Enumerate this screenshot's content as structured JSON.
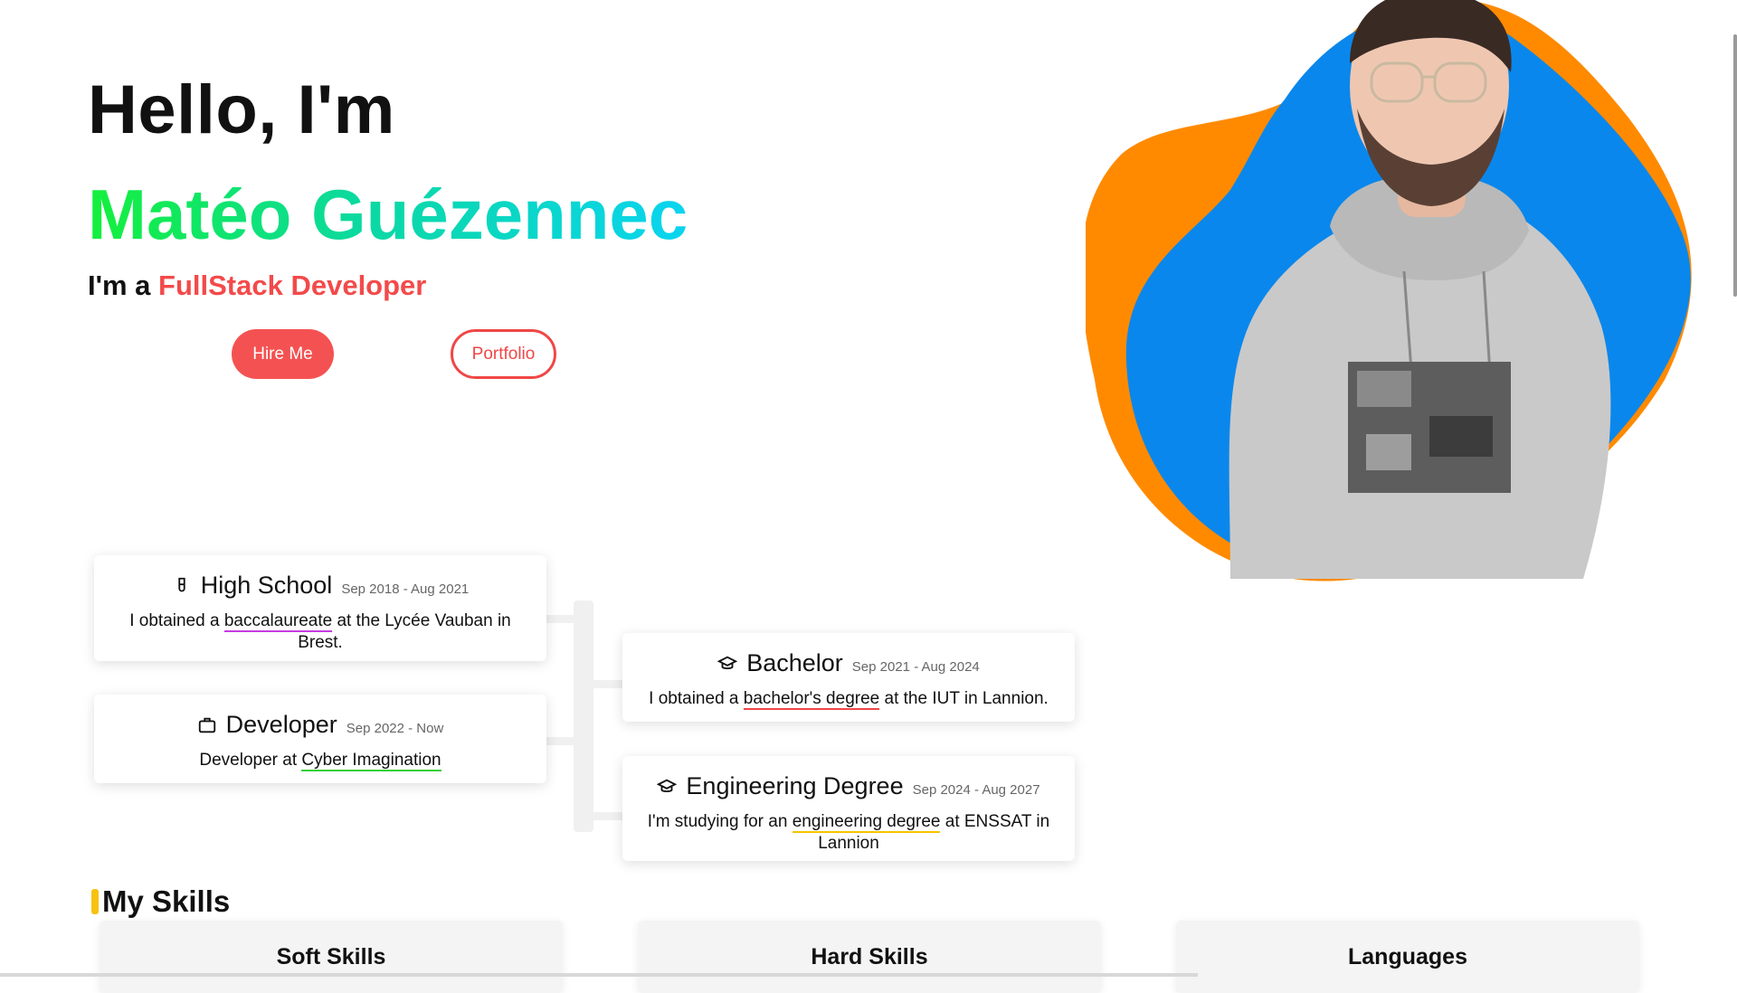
{
  "hero": {
    "greeting": "Hello, I'm",
    "name": "Matéo Guézennec",
    "role_prefix": "I'm a",
    "role": "FullStack Developer",
    "hire_label": "Hire Me",
    "portfolio_label": "Portfolio"
  },
  "timeline": {
    "high_school": {
      "title": "High School",
      "date": "Sep 2018 - Aug 2021",
      "desc_before": "I obtained a",
      "desc_link": "baccalaureate",
      "desc_after": "at the Lycée Vauban in Brest."
    },
    "bachelor": {
      "title": "Bachelor",
      "date": "Sep 2021 - Aug 2024",
      "desc_before": "I obtained a",
      "desc_link": "bachelor's degree",
      "desc_after": "at the IUT in Lannion."
    },
    "developer": {
      "title": "Developer",
      "date": "Sep 2022 - Now",
      "desc_before": "Developer at",
      "desc_link": "Cyber Imagination"
    },
    "engineering": {
      "title": "Engineering Degree",
      "date": "Sep 2024 - Aug 2027",
      "desc_before": "I'm studying for an",
      "desc_link": "engineering degree",
      "desc_after": "at ENSSAT in Lannion"
    }
  },
  "skills": {
    "heading": "My Skills",
    "cards": [
      "Soft Skills",
      "Hard Skills",
      "Languages"
    ]
  },
  "colors": {
    "accent_red": "#f45252",
    "name_gradient_start": "#14f03c",
    "name_gradient_end": "#0ad4f0",
    "blob_blue": "#0a87ec",
    "blob_orange": "#ff8a00",
    "skills_marker": "#f7c212"
  }
}
